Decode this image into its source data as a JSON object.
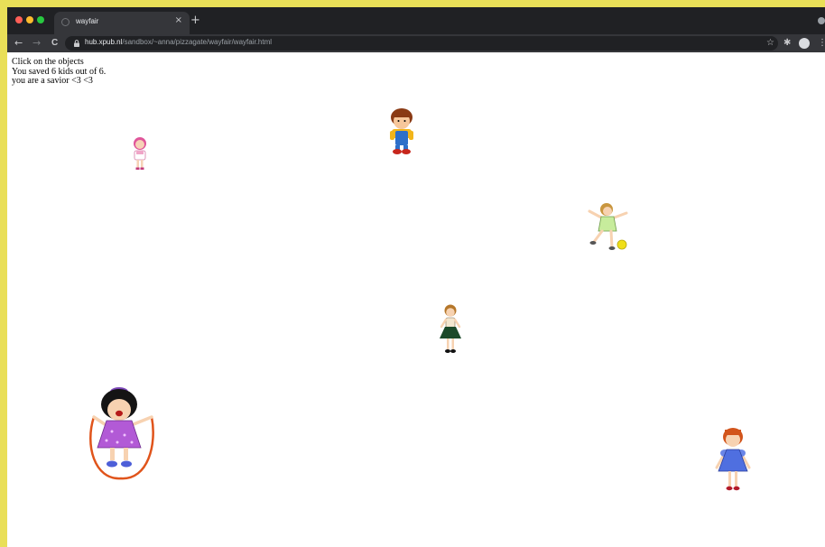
{
  "browser": {
    "tab_title": "wayfair",
    "tab_close": "×",
    "new_tab": "+",
    "url_host": "hub.xpub.nl",
    "url_path": "/sandbox/~anna/pizzagate/wayfair/wayfair.html",
    "nav": {
      "back": "←",
      "forward": "→",
      "reload": "C"
    },
    "bookmark": "☆",
    "extensions": "✱",
    "menu": "⋮"
  },
  "page": {
    "instruction": "Click on the objects",
    "score": "You saved 6 kids out of 6.",
    "result": "you are a savior <3 <3"
  },
  "colors": {
    "desktop": "#e9df58",
    "tabbar": "#202124",
    "toolbar": "#35363a",
    "close": "#ff5f57",
    "minimize": "#febc2e",
    "zoom": "#28c840"
  }
}
